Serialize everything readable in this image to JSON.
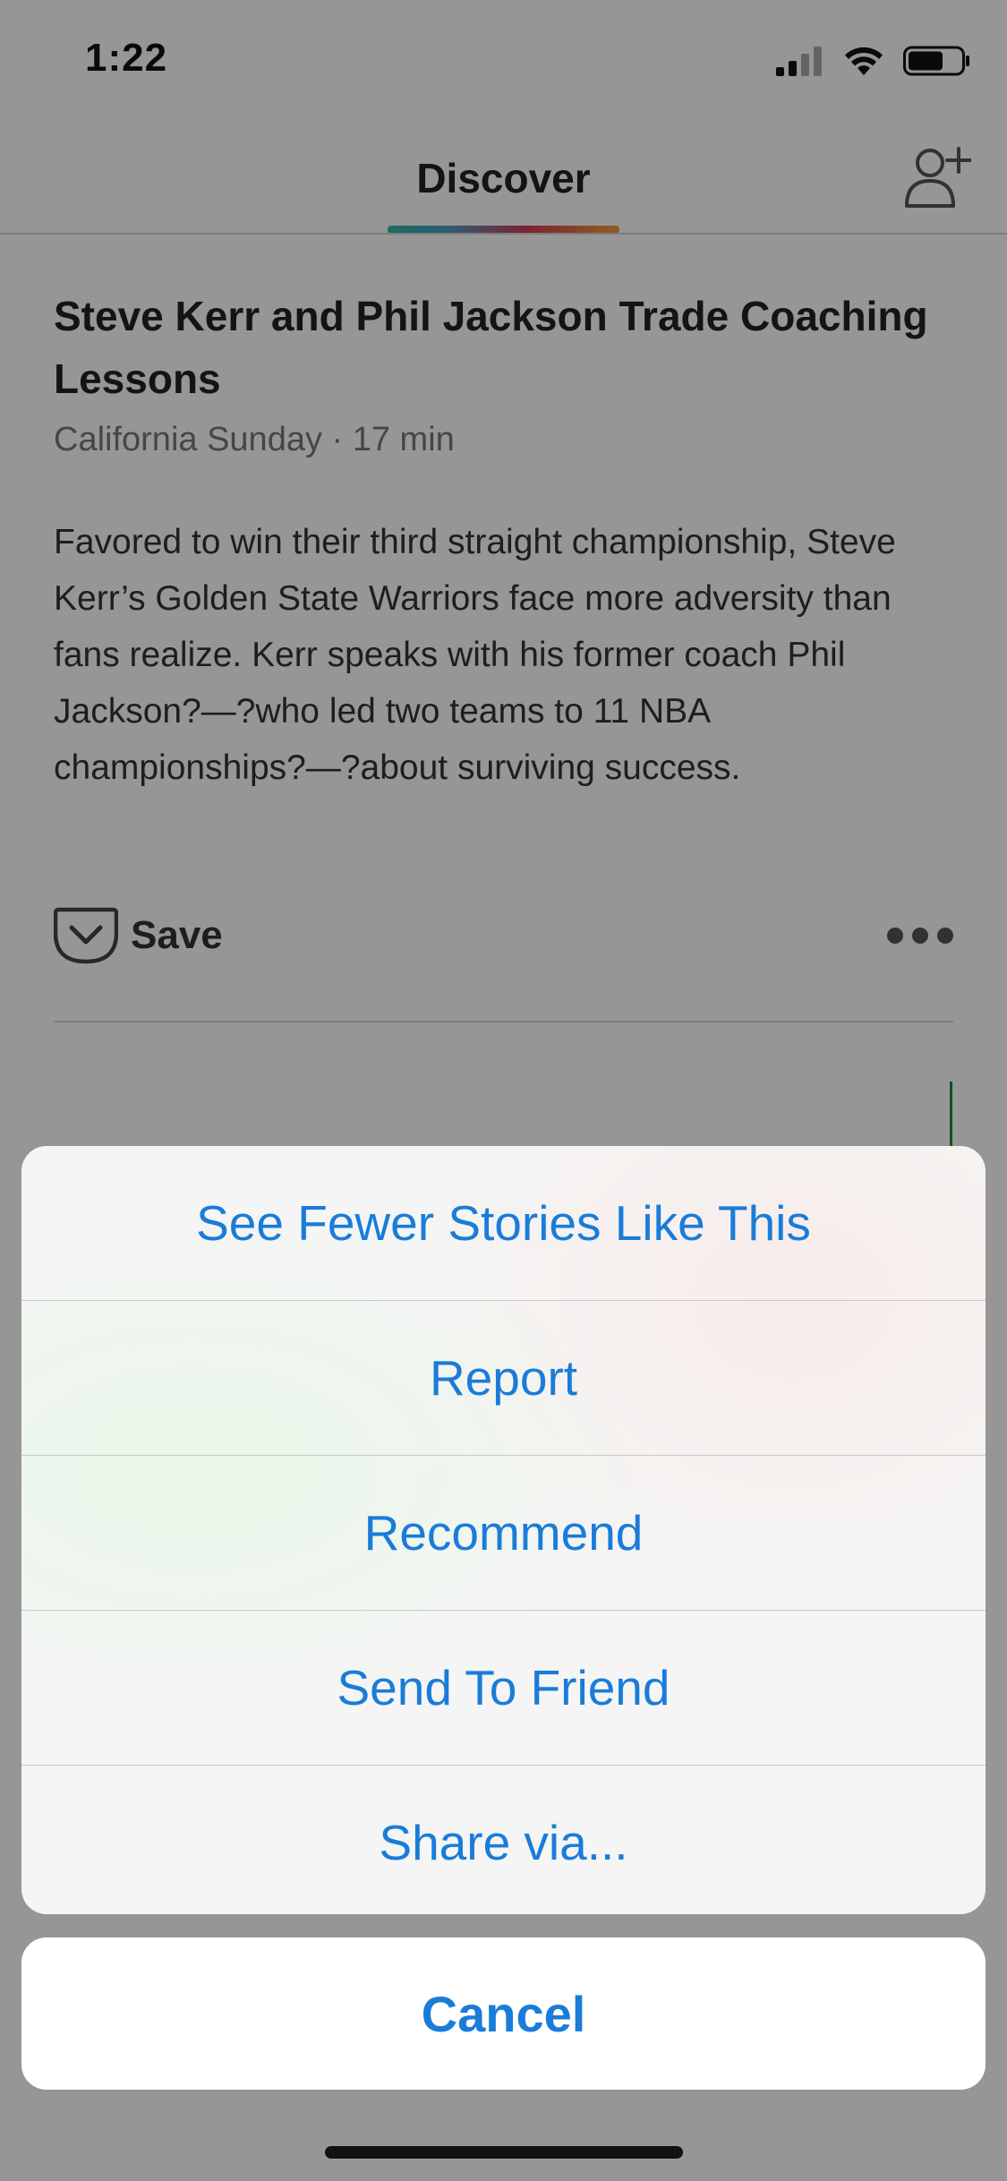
{
  "status_bar": {
    "time": "1:22",
    "icons": [
      "cellular-signal-icon",
      "wifi-icon",
      "battery-icon"
    ]
  },
  "header": {
    "title": "Discover",
    "add_friend_icon": "add-person-icon"
  },
  "article": {
    "title": "Steve Kerr and Phil Jackson Trade Coaching Lessons",
    "meta": "California Sunday · 17 min",
    "excerpt": "Favored to win their third straight championship, Steve Kerr’s Golden State Warriors face more adversity than fans realize. Kerr speaks with his former coach Phil Jackson?—?who led two teams to 11 NBA championships?—?about surviving success.",
    "save_label": "Save",
    "save_icon": "pocket-save-icon",
    "more_icon": "more-dots-icon"
  },
  "action_sheet": {
    "options": [
      {
        "label": "See Fewer Stories Like This"
      },
      {
        "label": "Report"
      },
      {
        "label": "Recommend"
      },
      {
        "label": "Send To Friend"
      },
      {
        "label": "Share via..."
      }
    ],
    "cancel_label": "Cancel"
  },
  "colors": {
    "action_blue": "#1a7cd9",
    "overlay": "rgba(0,0,0,0.41)",
    "tab_gradient": [
      "#36b6a0",
      "#4aa0c8",
      "#d63a5c",
      "#f0a23a"
    ]
  }
}
